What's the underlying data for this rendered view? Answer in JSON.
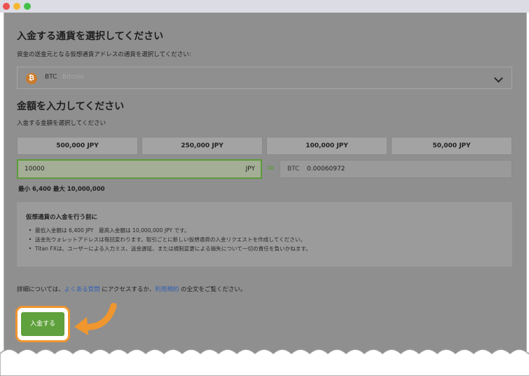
{
  "section1": {
    "title": "入金する通貨を選択してください",
    "subtitle": "資金の送金元となる仮想通貨アドレスの通貨を選択してください:",
    "currency_code": "BTC",
    "currency_name": "Bitcoin",
    "currency_icon_glyph": "₿"
  },
  "section2": {
    "title": "金額を入力してください",
    "subtitle": "入金する金額を選択してください",
    "presets": [
      "500,000 JPY",
      "250,000 JPY",
      "100,000 JPY",
      "50,000 JPY"
    ],
    "amount_value": "10000",
    "amount_currency": "JPY",
    "approx_symbol": "≈",
    "btc_code": "BTC",
    "btc_value": "0.00060972",
    "min_max": "最小 6,400  最大 10,000,000"
  },
  "notice": {
    "title": "仮想通貨の入金を行う前に",
    "items": [
      "最低入金額は 6,400 JPY　最高入金額は 10,000,000 JPY です。",
      "送金先ウォレットアドレスは毎回変わります。取引ごとに新しい仮想通貨の入金リクエストを作成してください。",
      "Titan FXは、ユーザーによる入力ミス、送金遅延、または規制変更による損失について一切の責任を負いかねます。"
    ]
  },
  "faq": {
    "prefix": "詳細については、",
    "faq_link": "よくある質問",
    "middle": " にアクセスするか、",
    "terms_link": "利用規約",
    "suffix": " の全文をご覧ください。"
  },
  "deposit_button": "入金する",
  "colors": {
    "accent_green": "#5fa13c",
    "highlight_orange": "#f0962e",
    "link_blue": "#2f5fb5"
  }
}
